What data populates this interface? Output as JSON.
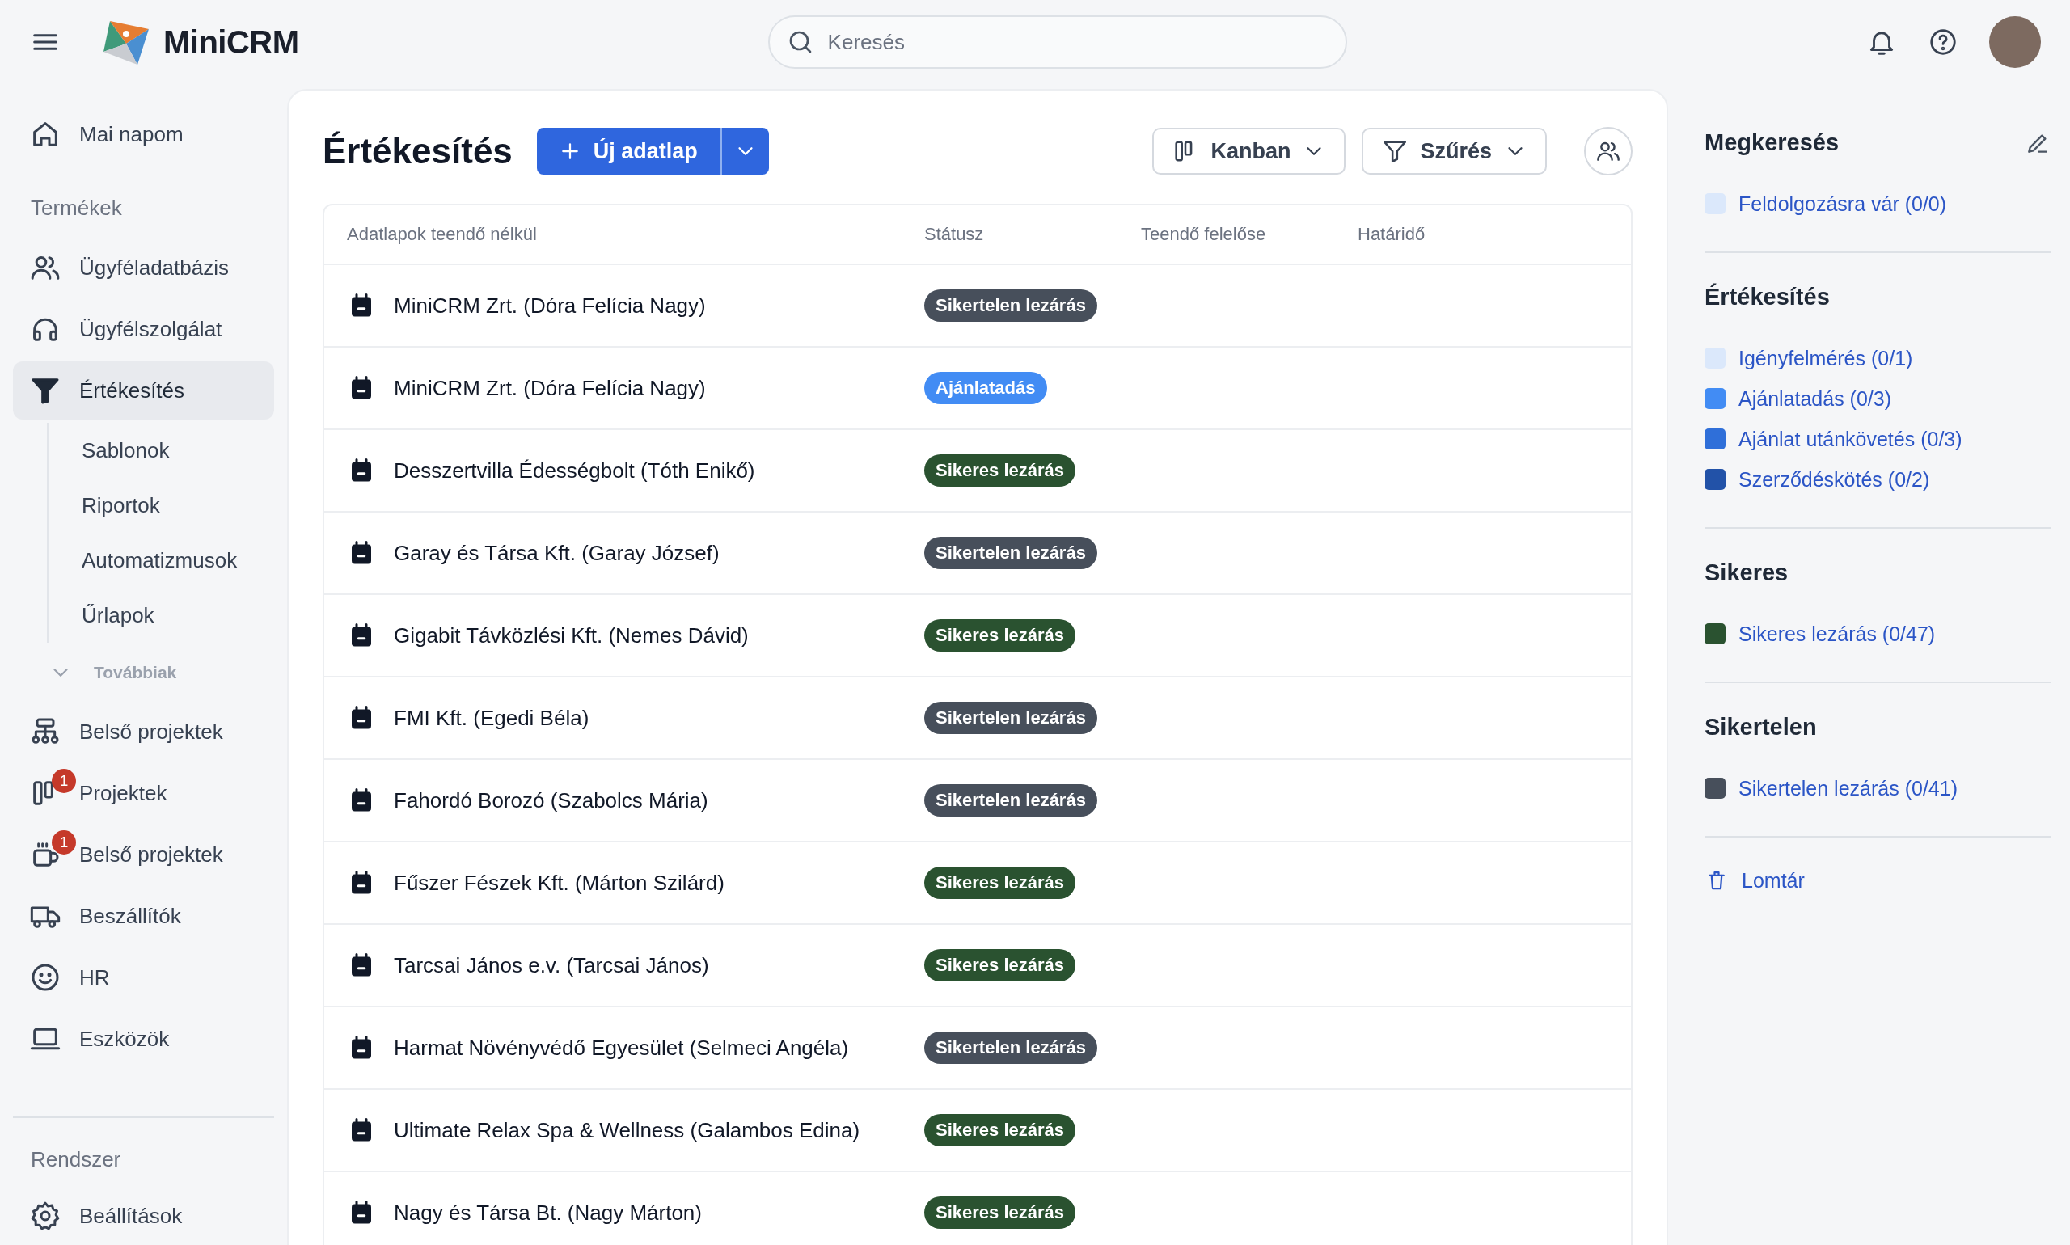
{
  "header": {
    "logo": "MiniCRM",
    "search": {
      "placeholder": "Keresés"
    }
  },
  "sidebar": {
    "items": [
      {
        "kind": "item",
        "label": "Mai napom",
        "selected": false
      },
      {
        "kind": "section",
        "label": "Termékek"
      },
      {
        "kind": "item",
        "label": "Ügyféladatbázis",
        "selected": false
      },
      {
        "kind": "item",
        "label": "Ügyfélszolgálat",
        "selected": false
      },
      {
        "kind": "item",
        "label": "Értékesítés",
        "selected": true
      },
      {
        "kind": "sub",
        "label": "Sablonok"
      },
      {
        "kind": "sub",
        "label": "Riportok"
      },
      {
        "kind": "sub",
        "label": "Automatizmusok"
      },
      {
        "kind": "sub",
        "label": "Űrlapok"
      },
      {
        "kind": "toggle",
        "label": "Továbbiak",
        "expanded": true
      },
      {
        "kind": "item",
        "label": "Belső projektek",
        "selected": false
      },
      {
        "kind": "item",
        "label": "Projektek",
        "selected": false,
        "badge": "1"
      },
      {
        "kind": "item",
        "label": "Belső projektek",
        "selected": false,
        "badge": "1"
      },
      {
        "kind": "item",
        "label": "Beszállítók",
        "selected": false
      },
      {
        "kind": "item",
        "label": "HR",
        "selected": false
      },
      {
        "kind": "item",
        "label": "Eszközök",
        "selected": false
      }
    ],
    "footer": {
      "section": "Rendszer",
      "item": "Beállítások"
    }
  },
  "main": {
    "title": "Értékesítés",
    "new_button": "Új adatlap",
    "view_button": "Kanban",
    "filter_button": "Szűrés",
    "table": {
      "columns": [
        "Adatlapok teendő nélkül",
        "Státusz",
        "Teendő felelőse",
        "Határidő"
      ],
      "rows": [
        {
          "name": "MiniCRM Zrt. (Dóra Felícia Nagy)",
          "status": "Sikertelen lezárás",
          "color": "#474f5b"
        },
        {
          "name": "MiniCRM Zrt. (Dóra Felícia Nagy)",
          "status": "Ajánlatadás",
          "color": "#428cf4"
        },
        {
          "name": "Desszertvilla Édességbolt (Tóth Enikő)",
          "status": "Sikeres lezárás",
          "color": "#2a5230"
        },
        {
          "name": "Garay és Társa Kft. (Garay József)",
          "status": "Sikertelen lezárás",
          "color": "#474f5b"
        },
        {
          "name": "Gigabit Távközlési Kft. (Nemes Dávid)",
          "status": "Sikeres lezárás",
          "color": "#2a5230"
        },
        {
          "name": "FMI Kft. (Egedi Béla)",
          "status": "Sikertelen lezárás",
          "color": "#474f5b"
        },
        {
          "name": "Fahordó Borozó (Szabolcs Mária)",
          "status": "Sikertelen lezárás",
          "color": "#474f5b"
        },
        {
          "name": "Fűszer Fészek Kft. (Márton Szilárd)",
          "status": "Sikeres lezárás",
          "color": "#2a5230"
        },
        {
          "name": "Tarcsai János e.v. (Tarcsai János)",
          "status": "Sikeres lezárás",
          "color": "#2a5230"
        },
        {
          "name": "Harmat Növényvédő Egyesület (Selmeci Angéla)",
          "status": "Sikertelen lezárás",
          "color": "#474f5b"
        },
        {
          "name": "Ultimate Relax Spa & Wellness (Galambos Edina)",
          "status": "Sikeres lezárás",
          "color": "#2a5230"
        },
        {
          "name": "Nagy és Társa Bt. (Nagy Márton)",
          "status": "Sikeres lezárás",
          "color": "#2a5230"
        }
      ]
    }
  },
  "panel": {
    "groups": [
      {
        "title": "Megkeresés",
        "items": [
          {
            "label": "Feldolgozásra vár (0/0)",
            "color": "#dbe8fb"
          }
        ]
      },
      {
        "title": "Értékesítés",
        "items": [
          {
            "label": "Igényfelmérés (0/1)",
            "color": "#dbe8fb"
          },
          {
            "label": "Ajánlatadás (0/3)",
            "color": "#428cf4"
          },
          {
            "label": "Ajánlat utánkövetés (0/3)",
            "color": "#2f6fd9"
          },
          {
            "label": "Szerződéskötés (0/2)",
            "color": "#2252a8"
          }
        ]
      },
      {
        "title": "Sikeres",
        "items": [
          {
            "label": "Sikeres lezárás (0/47)",
            "color": "#2a5230"
          }
        ]
      },
      {
        "title": "Sikertelen",
        "items": [
          {
            "label": "Sikertelen lezárás (0/41)",
            "color": "#474f5b"
          }
        ]
      }
    ],
    "trash": "Lomtár"
  }
}
